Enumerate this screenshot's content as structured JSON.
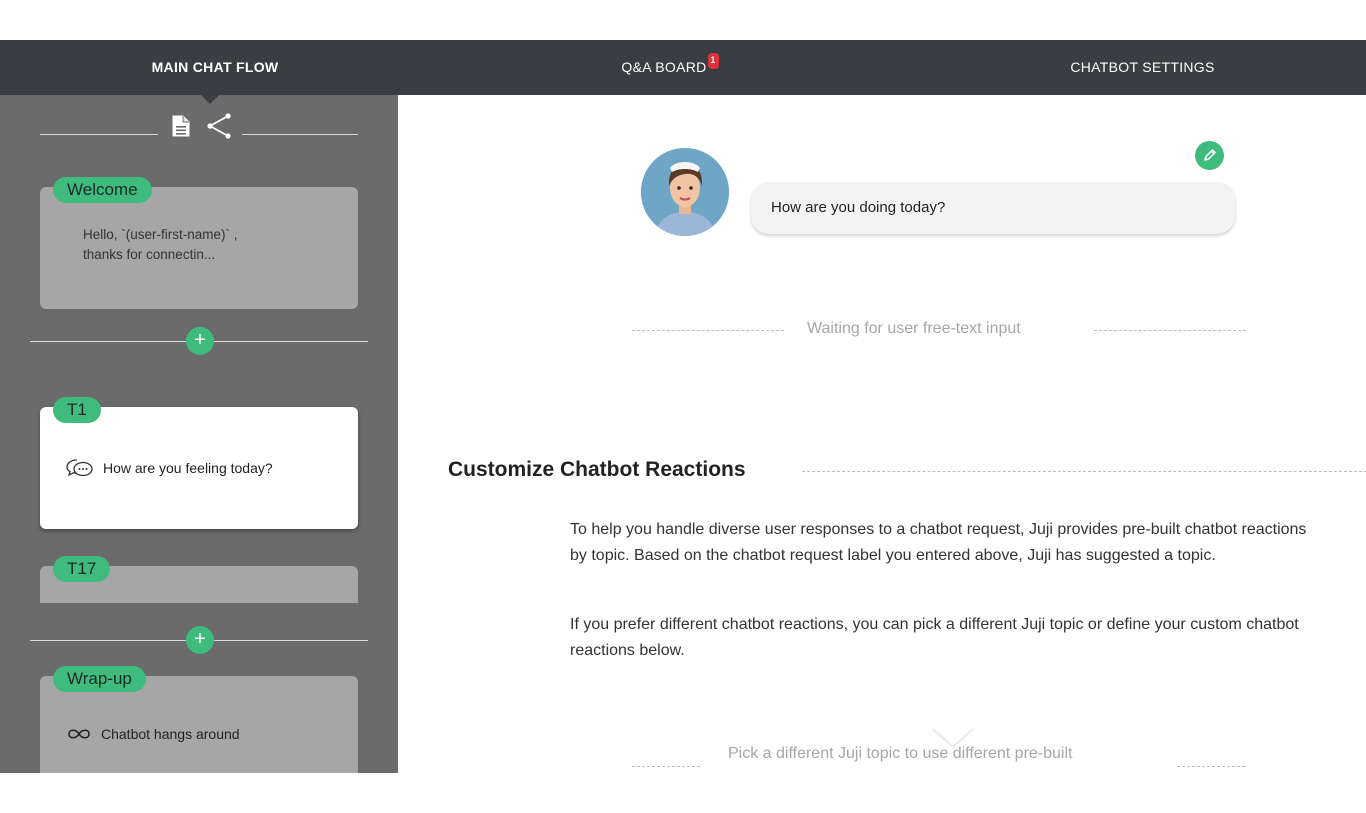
{
  "nav": {
    "tabs": [
      {
        "label": "MAIN CHAT FLOW",
        "active": true
      },
      {
        "label": "Q&A BOARD",
        "badge": "1"
      },
      {
        "label": "CHATBOT SETTINGS"
      }
    ]
  },
  "sidebar": {
    "cards": [
      {
        "tag": "Welcome",
        "text_line1": "Hello, `(user-first-name)` ,",
        "text_line2": "thanks for connectin..."
      },
      {
        "tag": "T1",
        "text": "How are you feeling today?",
        "icon": "chat-bubbles-icon"
      },
      {
        "tag": "T17"
      },
      {
        "tag": "Wrap-up",
        "text": "Chatbot hangs around",
        "icon": "infinity-icon"
      }
    ]
  },
  "main": {
    "bubble_text": "How are you doing today?",
    "waiting_text": "Waiting for user free-text input",
    "section_title": "Customize Chatbot Reactions",
    "paragraph1": "To help you handle diverse user responses to a chatbot request, Juji provides pre-built chatbot reactions by topic. Based on the chatbot request label you entered above, Juji has suggested a topic.",
    "paragraph2": "If you prefer different chatbot reactions, you can pick a different Juji topic or define your custom chatbot reactions below.",
    "pick_text": "Pick a different Juji topic to use different pre-built"
  },
  "colors": {
    "accent": "#3fbb7d",
    "navbar": "#3a3d42",
    "sidebar": "#6b6b6b",
    "badge": "#e0313d"
  }
}
